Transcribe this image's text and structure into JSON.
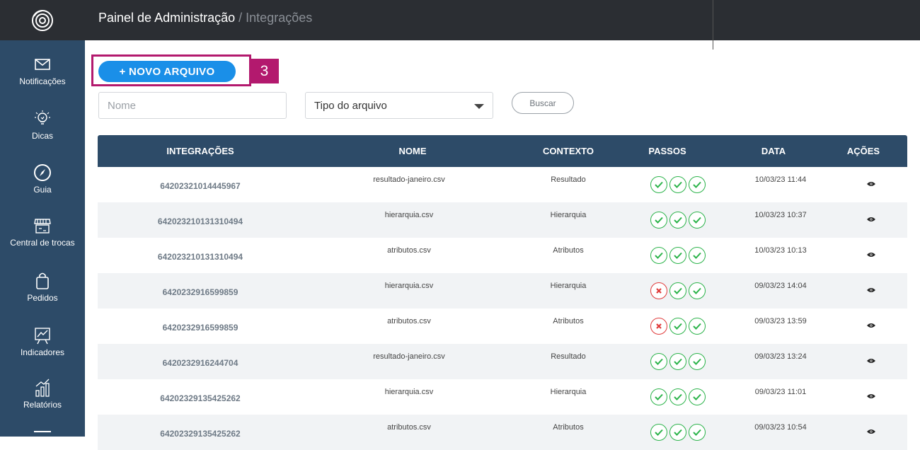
{
  "sidebar": {
    "items": [
      {
        "label": "Notificações",
        "icon": "envelope-icon"
      },
      {
        "label": "Dicas",
        "icon": "lightbulb-icon"
      },
      {
        "label": "Guia",
        "icon": "compass-icon"
      },
      {
        "label": "Central de trocas",
        "icon": "store-exchange-icon"
      },
      {
        "label": "Pedidos",
        "icon": "shopping-bag-icon"
      },
      {
        "label": "Indicadores",
        "icon": "chart-board-icon"
      },
      {
        "label": "Relatórios",
        "icon": "report-chart-icon"
      }
    ]
  },
  "header": {
    "breadcrumb_root": "Painel de Administração",
    "separator": "/",
    "breadcrumb_current": "Integrações"
  },
  "toolbar": {
    "new_file_label": "+ NOVO ARQUIVO",
    "highlight_number": "3",
    "name_placeholder": "Nome",
    "type_select_value": "Tipo do arquivo",
    "search_label": "Buscar"
  },
  "table": {
    "columns": [
      "INTEGRAÇÕES",
      "NOME",
      "CONTEXTO",
      "PASSOS",
      "DATA",
      "AÇÕES"
    ],
    "rows": [
      {
        "id": "64202321014445967",
        "name": "resultado-janeiro.csv",
        "context": "Resultado",
        "steps": [
          "ok",
          "ok",
          "ok"
        ],
        "date": "10/03/23 11:44"
      },
      {
        "id": "642023210131310494",
        "name": "hierarquia.csv",
        "context": "Hierarquia",
        "steps": [
          "ok",
          "ok",
          "ok"
        ],
        "date": "10/03/23 10:37"
      },
      {
        "id": "642023210131310494",
        "name": "atributos.csv",
        "context": "Atributos",
        "steps": [
          "ok",
          "ok",
          "ok"
        ],
        "date": "10/03/23 10:13"
      },
      {
        "id": "6420232916599859",
        "name": "hierarquia.csv",
        "context": "Hierarquia",
        "steps": [
          "error",
          "ok",
          "ok"
        ],
        "date": "09/03/23 14:04"
      },
      {
        "id": "6420232916599859",
        "name": "atributos.csv",
        "context": "Atributos",
        "steps": [
          "error",
          "ok",
          "ok"
        ],
        "date": "09/03/23 13:59"
      },
      {
        "id": "6420232916244704",
        "name": "resultado-janeiro.csv",
        "context": "Resultado",
        "steps": [
          "ok",
          "ok",
          "ok"
        ],
        "date": "09/03/23 13:24"
      },
      {
        "id": "64202329135425262",
        "name": "hierarquia.csv",
        "context": "Hierarquia",
        "steps": [
          "ok",
          "ok",
          "ok"
        ],
        "date": "09/03/23 11:01"
      },
      {
        "id": "64202329135425262",
        "name": "atributos.csv",
        "context": "Atributos",
        "steps": [
          "ok",
          "ok",
          "ok"
        ],
        "date": "09/03/23 10:54"
      }
    ]
  },
  "colors": {
    "sidebar": "#2d4b68",
    "topbar": "#2b2e33",
    "primary_button": "#1a8fe8",
    "highlight": "#b3196e",
    "step_ok": "#2bb34a",
    "step_error": "#e03a3a"
  }
}
